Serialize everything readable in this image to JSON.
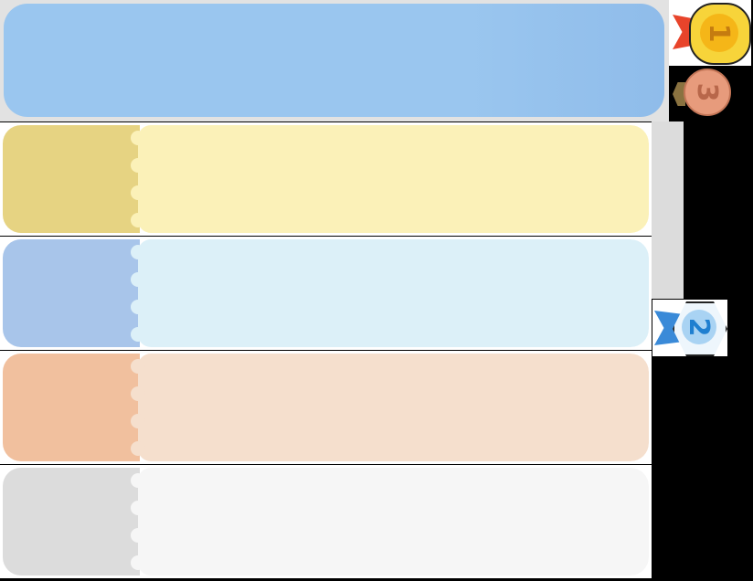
{
  "medals": [
    {
      "rank": "1",
      "color": "#f7c31d",
      "ribbon": "#e8442b"
    },
    {
      "rank": "2",
      "color": "#cfe6f7",
      "ribbon": "#3a8ad8"
    },
    {
      "rank": "3",
      "color": "#e79b7c",
      "ribbon": "#8a7240"
    }
  ],
  "rows": [
    {
      "name": "yellow",
      "left": "#e6d382",
      "right": "#fbf1b8"
    },
    {
      "name": "blue",
      "left": "#a8c5ea",
      "right": "#dcf0f8"
    },
    {
      "name": "orange",
      "left": "#f1c09e",
      "right": "#f5dfcd"
    },
    {
      "name": "gray",
      "left": "#dcdcdc",
      "right": "#f6f6f6"
    }
  ]
}
